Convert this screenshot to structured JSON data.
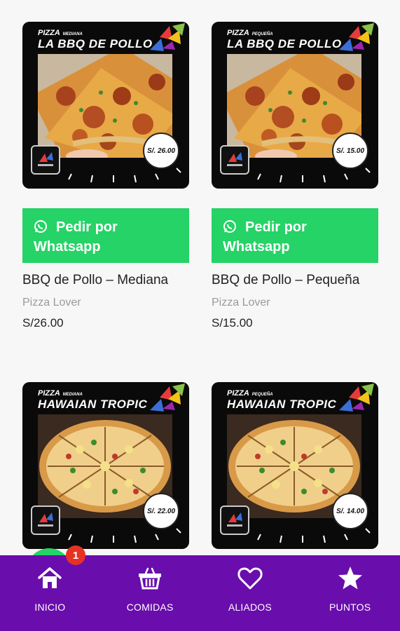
{
  "products": [
    {
      "promo_small": "PIZZA",
      "promo_size": "MEDIANA",
      "promo_big": "LA BBQ DE POLLO",
      "promo_price": "S/. 26.00",
      "whatsapp_label": "Pedir por Whatsapp",
      "title": "BBQ de Pollo – Mediana",
      "vendor": "Pizza Lover",
      "price": "S/26.00"
    },
    {
      "promo_small": "PIZZA",
      "promo_size": "PEQUEÑA",
      "promo_big": "LA BBQ DE POLLO",
      "promo_price": "S/. 15.00",
      "whatsapp_label": "Pedir por Whatsapp",
      "title": "BBQ de Pollo – Pequeña",
      "vendor": "Pizza Lover",
      "price": "S/15.00"
    },
    {
      "promo_small": "PIZZA",
      "promo_size": "MEDIANA",
      "promo_big": "HAWAIAN TROPIC",
      "promo_price": "S/. 22.00"
    },
    {
      "promo_small": "PIZZA",
      "promo_size": "PEQUEÑA",
      "promo_big": "HAWAIAN TROPIC",
      "promo_price": "S/. 14.00"
    }
  ],
  "fab_badge": "1",
  "nav": [
    {
      "label": "INICIO",
      "icon": "home-icon"
    },
    {
      "label": "COMIDAS",
      "icon": "basket-icon"
    },
    {
      "label": "ALIADOS",
      "icon": "heart-icon"
    },
    {
      "label": "PUNTOS",
      "icon": "star-icon"
    }
  ],
  "colors": {
    "whatsapp_green": "#25d366",
    "nav_purple": "#6a0dad",
    "badge_red": "#e53224"
  }
}
